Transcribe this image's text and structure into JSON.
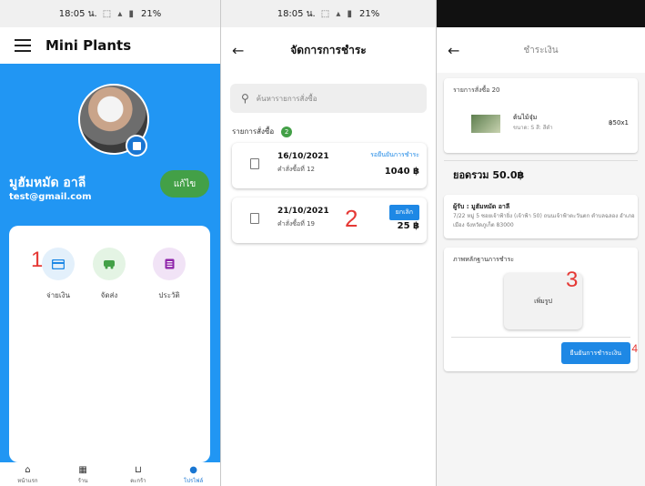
{
  "screen1": {
    "status": "18:05 น.",
    "status_right": "21%",
    "app_title": "Mini Plants",
    "user_name": "มูฮัมหมัด อาลี",
    "email": "test@gmail.com",
    "edit_label": "แก้ไข",
    "menu": [
      {
        "label": "จ่ายเงิน",
        "icon": "payment-card-icon",
        "color": "#e3f0fb"
      },
      {
        "label": "จัดส่ง",
        "icon": "truck-icon",
        "color": "#e4f4e4"
      },
      {
        "label": "ประวัติ",
        "icon": "history-icon",
        "color": "#f1e3f6"
      }
    ],
    "annotation": "1",
    "bottom_nav": [
      {
        "label": "หน้าแรก",
        "icon": "home-icon"
      },
      {
        "label": "ร้าน",
        "icon": "store-icon"
      },
      {
        "label": "ตะกร้า",
        "icon": "basket-icon"
      },
      {
        "label": "โปรไฟล์",
        "icon": "profile-icon",
        "active": true
      }
    ]
  },
  "screen2": {
    "status": "18:05 น.",
    "status_right": "21%",
    "title": "จัดการการชำระ",
    "search_placeholder": "ค้นหารายการสั่งซื้อ",
    "list_label": "รายการสั่งซื้อ",
    "count": "2",
    "orders": [
      {
        "date": "16/10/2021",
        "order_no": "คำสั่งซื้อที่ 12",
        "status": "รอยืนยันการชำระ",
        "price": "1040 ฿"
      },
      {
        "date": "21/10/2021",
        "order_no": "คำสั่งซื้อที่ 19",
        "status": "ยกเลิก",
        "price": "25 ฿"
      }
    ],
    "annotation": "2"
  },
  "screen3": {
    "title": "ชำระเงิน",
    "order_label": "รายการสั่งซื้อ 20",
    "product_name": "ต้นไม้จุ๋ม",
    "product_detail": "ขนาด: S สี: สีดำ",
    "product_price": "฿50x1",
    "total": "ยอดรวม 50.0฿",
    "recipient": "ผู้รับ : มูฮัมหมัด อาลี",
    "address": "7/22 หมู่ 5 ซอยเจ้าฟ้ายิ่ง (เจ้าฟ้า 50) ถนนเจ้าฟ้าตะวันตก ตำบลฉลอง อำเภอเมือง จังหวัดภูเก็ต 83000",
    "proof_label": "ภาพหลักฐานการชำระ",
    "add_photo": "เพิ่มรูป",
    "confirm_label": "ยืนยันการชำระเงิน",
    "annotation3": "3",
    "annotation4": "4"
  }
}
